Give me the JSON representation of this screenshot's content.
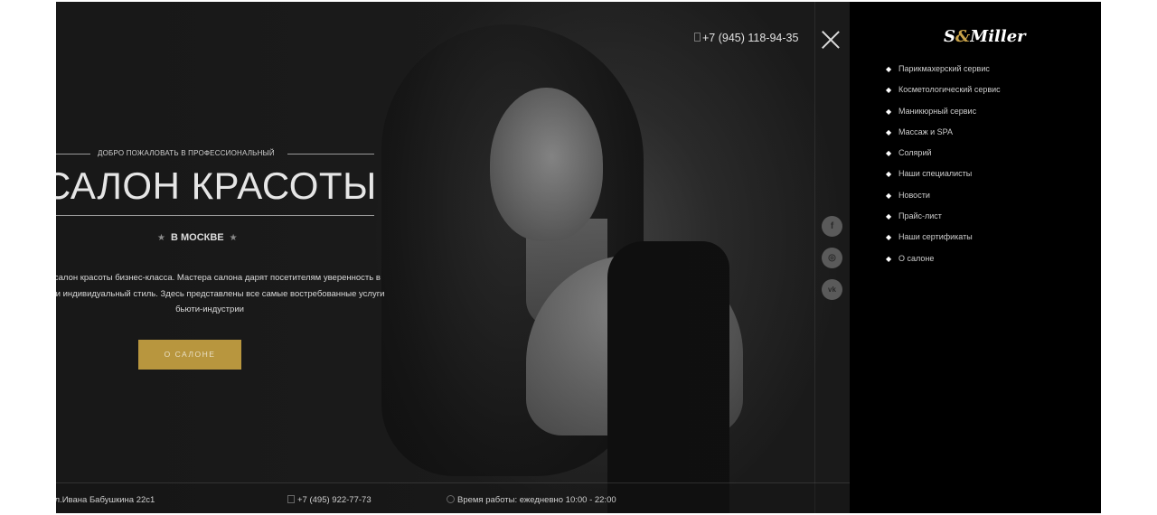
{
  "header": {
    "phone": "+7 (945) 118-94-35"
  },
  "hero": {
    "welcome": "ДОБРО ПОЖАЛОВАТЬ В ПРОФЕССИОНАЛЬНЫЙ",
    "title": "САЛОН КРАСОТЫ",
    "city": "В МОСКВЕ",
    "description": "это салон красоты бизнес-класса. Мастера салона дарят посетителям уверенность в себе и индивидуальный стиль. Здесь представлены все самые востребованные услуги бьюти-индустрии",
    "button": "О САЛОНЕ"
  },
  "social": [
    "facebook-icon",
    "instagram-icon",
    "vk-icon"
  ],
  "social_glyphs": [
    "f",
    "◎",
    "vk"
  ],
  "footer": {
    "address": "ул.Ивана Бабушкина 22с1",
    "phone": "+7 (495) 922-77-73",
    "hours": "Время работы: ежедневно 10:00 - 22:00"
  },
  "sidebar": {
    "logo_first": "S",
    "logo_amp": "&",
    "logo_rest": "Miller",
    "menu": [
      "Парикмахерский сервис",
      "Косметологический сервис",
      "Маникюрный сервис",
      "Массаж и SPA",
      "Солярий",
      "Наши специалисты",
      "Новости",
      "Прайс-лист",
      "Наши сертификаты",
      "О салоне"
    ]
  },
  "colors": {
    "accent": "#b8963e",
    "sidebar_bg": "#000000",
    "hero_bg": "#1a1a1a"
  }
}
